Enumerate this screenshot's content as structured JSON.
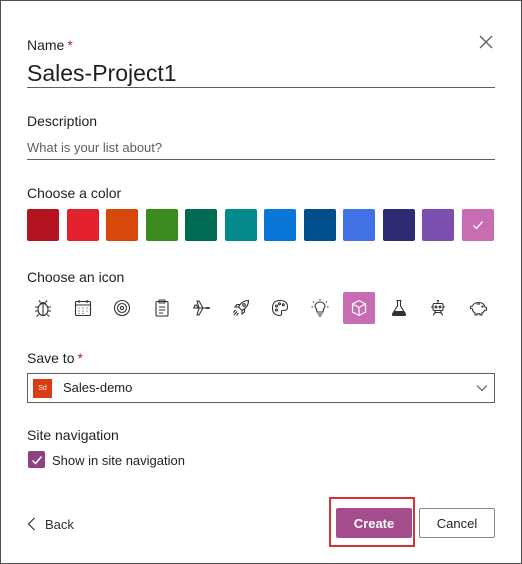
{
  "form": {
    "name_label": "Name",
    "required_marker": "*",
    "name_value": "Sales-Project1",
    "description_label": "Description",
    "description_placeholder": "What is your list about?",
    "color_label": "Choose a color",
    "icon_label": "Choose an icon",
    "save_to_label": "Save to",
    "site_navigation_label": "Site navigation"
  },
  "colors": [
    "#b3121f",
    "#e3202e",
    "#d9480b",
    "#3a8a1f",
    "#006a53",
    "#038a8a",
    "#0a76d8",
    "#004e8c",
    "#4272e6",
    "#2f2a75",
    "#7b4fb0",
    "#c86db2"
  ],
  "selected_color_index": 11,
  "icons": [
    "bug-icon",
    "calendar-icon",
    "target-icon",
    "clipboard-icon",
    "airplane-icon",
    "rocket-icon",
    "palette-icon",
    "lightbulb-icon",
    "cube-icon",
    "beaker-icon",
    "robot-icon",
    "piggy-bank-icon"
  ],
  "selected_icon_index": 8,
  "save_to": {
    "site_logo_text": "Sd",
    "site_name": "Sales-demo"
  },
  "navigation": {
    "checked": true,
    "checkbox_label": "Show in site navigation"
  },
  "footer": {
    "back_label": "Back",
    "create_label": "Create",
    "cancel_label": "Cancel"
  }
}
